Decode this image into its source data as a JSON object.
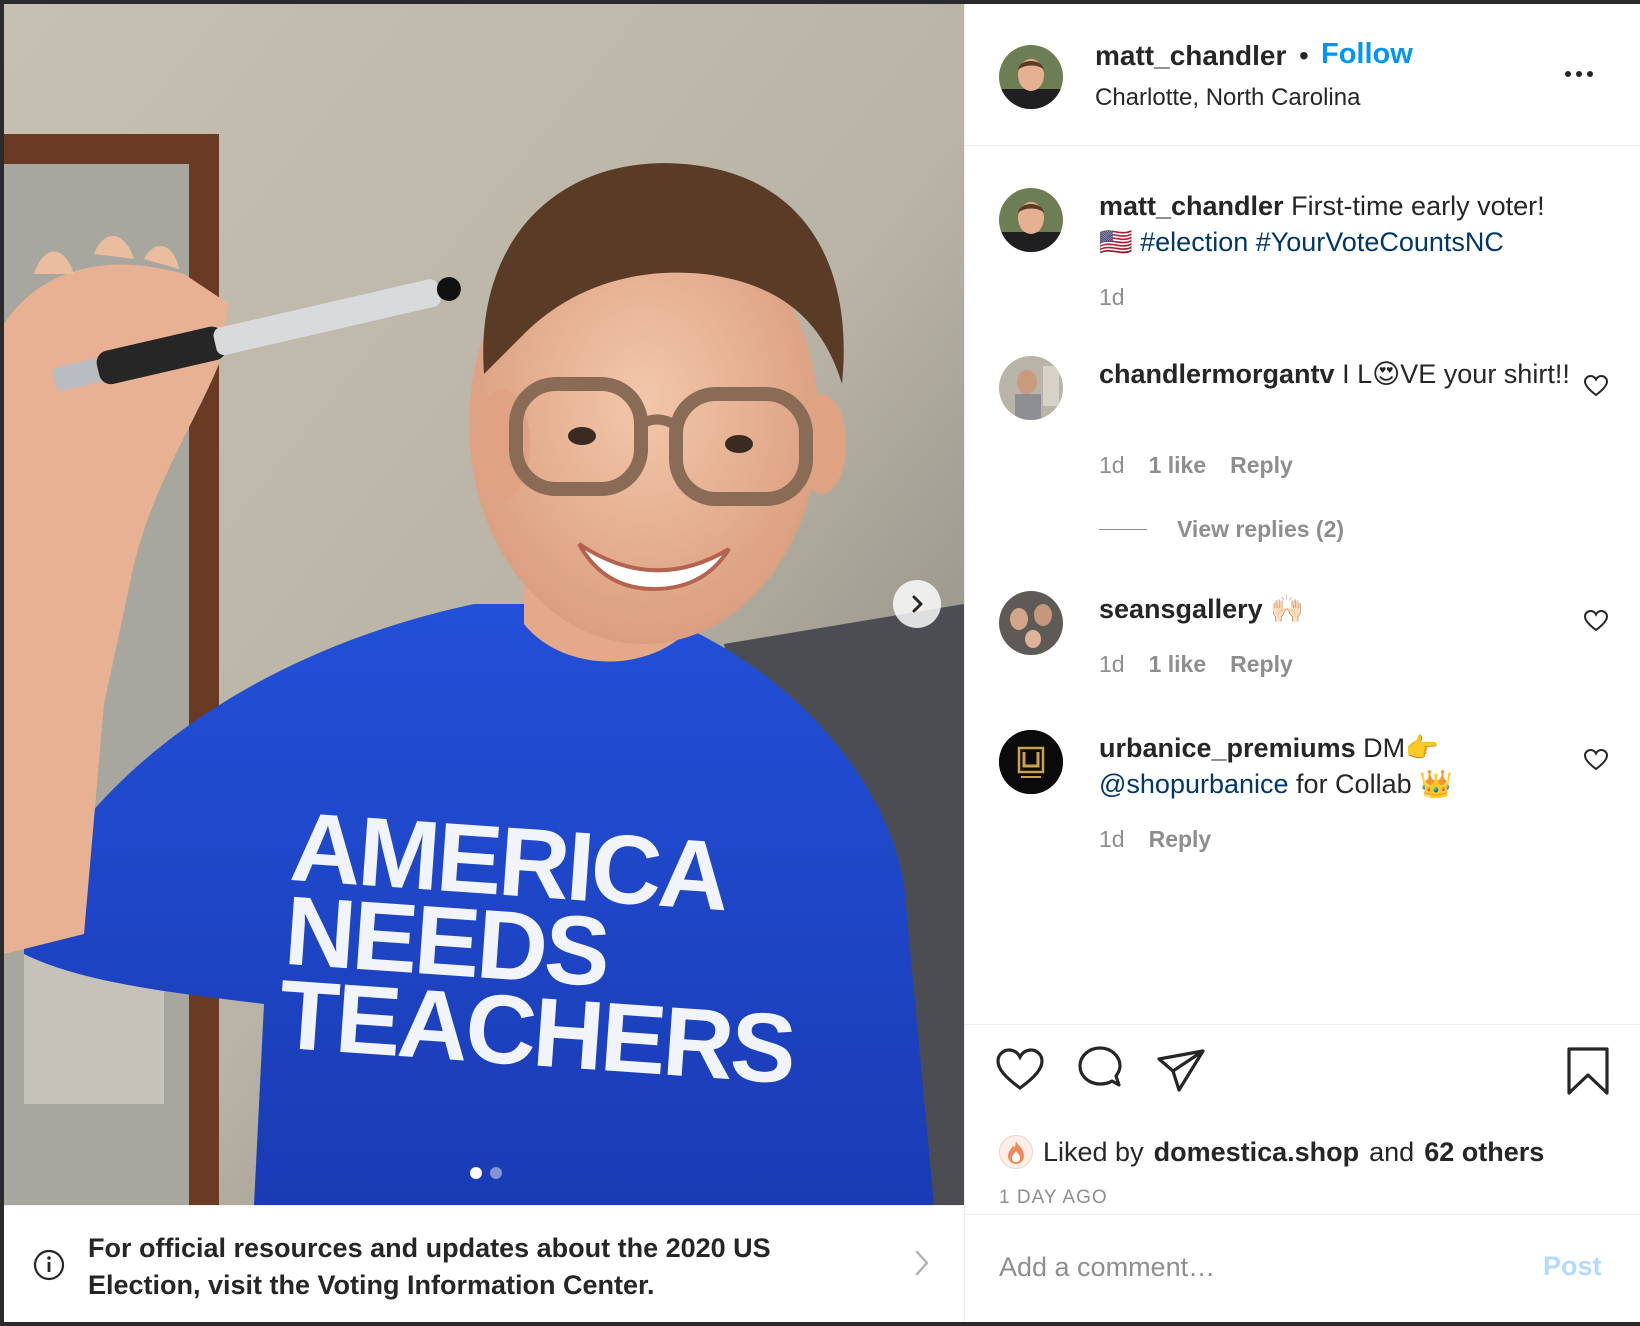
{
  "post": {
    "username": "matt_chandler",
    "separator": "•",
    "follow_label": "Follow",
    "location": "Charlotte, North Carolina",
    "shirt_lines": [
      "AMERICA",
      "NEEDS",
      "TEACHERS"
    ],
    "carousel": {
      "total": 2,
      "active": 1
    }
  },
  "banner": {
    "text": "For official resources and updates about the 2020 US Election, visit the Voting Information Center."
  },
  "caption": {
    "username": "matt_chandler",
    "text": "First-time early voter!",
    "flag": "🇺🇸",
    "hashtags": "#election #YourVoteCountsNC",
    "time": "1d"
  },
  "comments": [
    {
      "username": "chandlermorgantv",
      "text_1": "I L",
      "emoji": "😍",
      "text_2": "VE your shirt!!",
      "time": "1d",
      "likes": "1 like",
      "reply_label": "Reply",
      "view_replies": "View replies (2)"
    },
    {
      "username": "seansgallery",
      "emoji": "🙌🏻",
      "time": "1d",
      "likes": "1 like",
      "reply_label": "Reply"
    },
    {
      "username": "urbanice_premiums",
      "text_1": "DM",
      "emoji_1": "👉",
      "mention": "@shopurbanice",
      "text_2": "for Collab",
      "emoji_2": "👑",
      "time": "1d",
      "reply_label": "Reply"
    }
  ],
  "likes": {
    "prefix": "Liked by",
    "liker": "domestica.shop",
    "middle": "and",
    "others": "62 others"
  },
  "posted_ago": "1 DAY AGO",
  "comment_box": {
    "placeholder": "Add a comment…",
    "post_label": "Post"
  },
  "colors": {
    "follow_blue": "#0095f6",
    "hashtag_blue": "#00376b",
    "muted": "#8e8e8e",
    "post_disabled": "#b3dbff",
    "shirt_blue": "#1d43c8"
  },
  "icons": [
    "chevron-right-icon",
    "info-icon",
    "more-icon",
    "heart-icon",
    "comment-icon",
    "share-icon",
    "bookmark-icon"
  ]
}
